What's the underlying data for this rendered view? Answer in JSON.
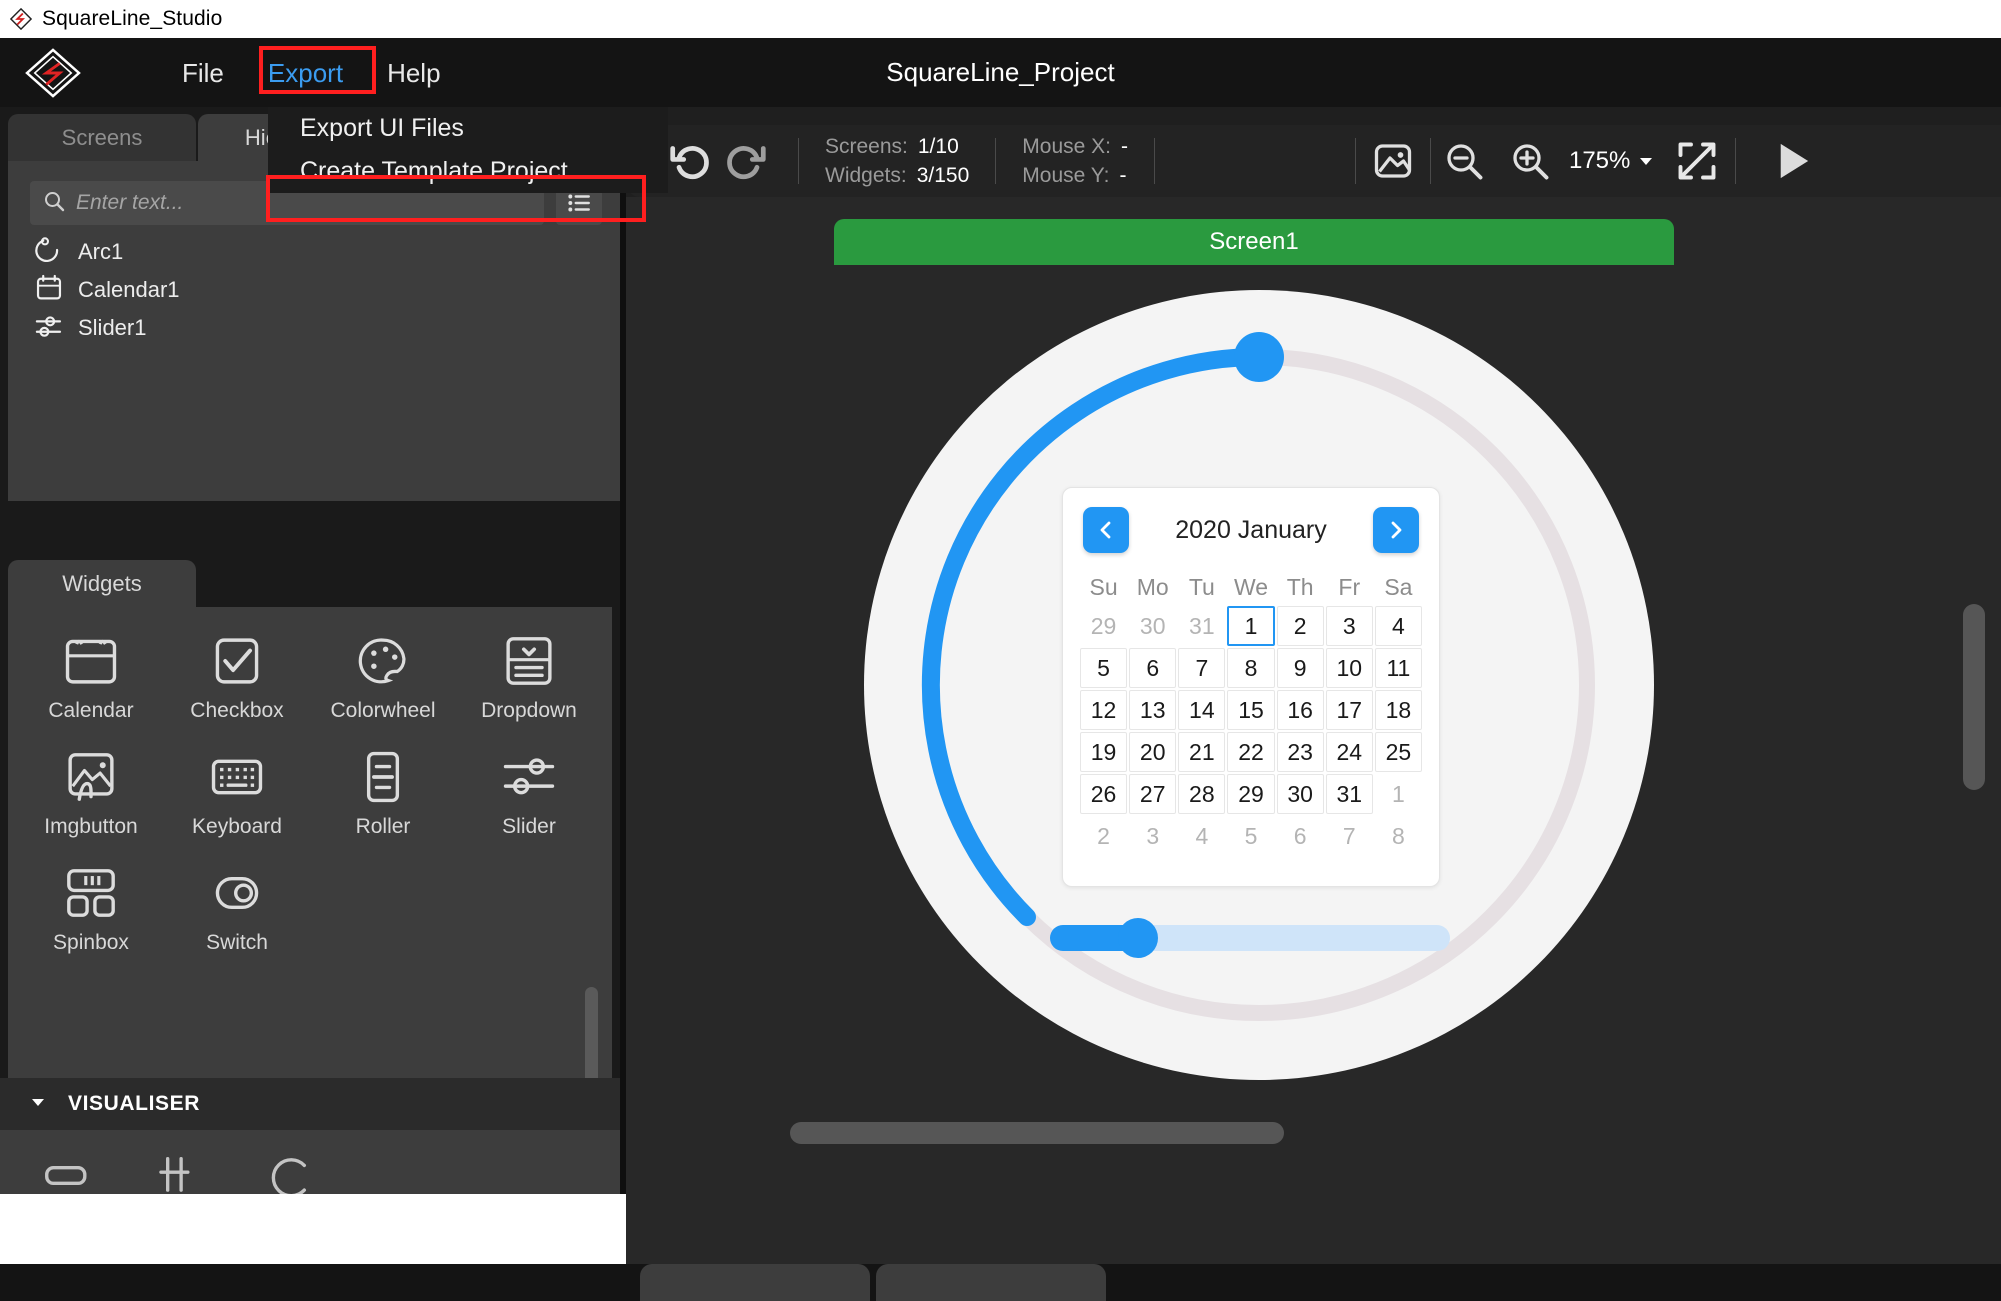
{
  "window": {
    "os_title": "SquareLine_Studio",
    "app_icon": "squareline-logo-icon"
  },
  "menubar": {
    "project_title": "SquareLine_Project",
    "items": [
      {
        "label": "File",
        "active": false
      },
      {
        "label": "Export",
        "active": true
      },
      {
        "label": "Help",
        "active": false
      }
    ],
    "highlight_color": "#ff1f1f",
    "active_color": "#3b9cf0"
  },
  "export_menu": {
    "open": true,
    "items": [
      {
        "label": "Export UI Files",
        "highlighted": false
      },
      {
        "label": "Create Template Project",
        "highlighted": true
      }
    ]
  },
  "left_panel": {
    "tree_tabs": [
      {
        "label": "Screens",
        "selected": false
      },
      {
        "label": "Hierarchy",
        "selected": true
      }
    ],
    "search": {
      "value": "",
      "placeholder": "Enter text...",
      "icon": "search-icon"
    },
    "list_view_icon": "list-view-icon",
    "tree_items": [
      {
        "label": "Arc1",
        "icon": "arc-icon"
      },
      {
        "label": "Calendar1",
        "icon": "calendar-icon"
      },
      {
        "label": "Slider1",
        "icon": "slider-icon"
      }
    ],
    "widgets_tab": {
      "label": "Widgets",
      "selected": true
    },
    "widgets": [
      {
        "label": "Calendar",
        "icon": "calendar-icon"
      },
      {
        "label": "Checkbox",
        "icon": "checkbox-icon"
      },
      {
        "label": "Colorwheel",
        "icon": "palette-icon"
      },
      {
        "label": "Dropdown",
        "icon": "dropdown-icon"
      },
      {
        "label": "Imgbutton",
        "icon": "image-button-icon"
      },
      {
        "label": "Keyboard",
        "icon": "keyboard-icon"
      },
      {
        "label": "Roller",
        "icon": "roller-icon"
      },
      {
        "label": "Slider",
        "icon": "slider-icon"
      },
      {
        "label": "Spinbox",
        "icon": "spinbox-icon"
      },
      {
        "label": "Switch",
        "icon": "switch-icon"
      }
    ],
    "visualiser": {
      "title": "VISUALISER",
      "expanded": true,
      "chevron_icon": "chevron-down-icon"
    }
  },
  "toolbar": {
    "undo_icon": "undo-icon",
    "redo_icon": "redo-icon",
    "stats": [
      {
        "label": "Screens:",
        "value": "1/10"
      },
      {
        "label": "Widgets:",
        "value": "3/150"
      }
    ],
    "mouse": [
      {
        "label": "Mouse X:",
        "value": "-"
      },
      {
        "label": "Mouse Y:",
        "value": "-"
      }
    ],
    "image_icon": "image-icon",
    "zoom_out_icon": "zoom-out-icon",
    "zoom_in_icon": "zoom-in-icon",
    "zoom_level": "175%",
    "zoom_dropdown_icon": "chevron-down-icon",
    "fit_screen_icon": "fit-screen-icon",
    "play_icon": "play-icon"
  },
  "canvas": {
    "screen_label": "Screen1",
    "screen_label_color": "#2a9a3f",
    "accent_color": "#2196f3",
    "arc": {
      "value_percent": 62,
      "track_color": "#e6e0e3",
      "indicator_color": "#2196f3",
      "knob_icon": "arc-knob-icon"
    },
    "calendar": {
      "title": "2020 January",
      "prev_icon": "chevron-left-icon",
      "next_icon": "chevron-right-icon",
      "day_headers": [
        "Su",
        "Mo",
        "Tu",
        "We",
        "Th",
        "Fr",
        "Sa"
      ],
      "today": "1",
      "weeks": [
        [
          {
            "d": "29",
            "muted": true
          },
          {
            "d": "30",
            "muted": true
          },
          {
            "d": "31",
            "muted": true
          },
          {
            "d": "1",
            "muted": false,
            "today": true
          },
          {
            "d": "2",
            "muted": false
          },
          {
            "d": "3",
            "muted": false
          },
          {
            "d": "4",
            "muted": false
          }
        ],
        [
          {
            "d": "5",
            "muted": false
          },
          {
            "d": "6",
            "muted": false
          },
          {
            "d": "7",
            "muted": false
          },
          {
            "d": "8",
            "muted": false
          },
          {
            "d": "9",
            "muted": false
          },
          {
            "d": "10",
            "muted": false
          },
          {
            "d": "11",
            "muted": false
          }
        ],
        [
          {
            "d": "12",
            "muted": false
          },
          {
            "d": "13",
            "muted": false
          },
          {
            "d": "14",
            "muted": false
          },
          {
            "d": "15",
            "muted": false
          },
          {
            "d": "16",
            "muted": false
          },
          {
            "d": "17",
            "muted": false
          },
          {
            "d": "18",
            "muted": false
          }
        ],
        [
          {
            "d": "19",
            "muted": false
          },
          {
            "d": "20",
            "muted": false
          },
          {
            "d": "21",
            "muted": false
          },
          {
            "d": "22",
            "muted": false
          },
          {
            "d": "23",
            "muted": false
          },
          {
            "d": "24",
            "muted": false
          },
          {
            "d": "25",
            "muted": false
          }
        ],
        [
          {
            "d": "26",
            "muted": false
          },
          {
            "d": "27",
            "muted": false
          },
          {
            "d": "28",
            "muted": false
          },
          {
            "d": "29",
            "muted": false
          },
          {
            "d": "30",
            "muted": false
          },
          {
            "d": "31",
            "muted": false
          },
          {
            "d": "1",
            "muted": true
          }
        ],
        [
          {
            "d": "2",
            "muted": true
          },
          {
            "d": "3",
            "muted": true
          },
          {
            "d": "4",
            "muted": true
          },
          {
            "d": "5",
            "muted": true
          },
          {
            "d": "6",
            "muted": true
          },
          {
            "d": "7",
            "muted": true
          },
          {
            "d": "8",
            "muted": true
          }
        ]
      ]
    },
    "slider": {
      "value_percent": 22,
      "track_color": "#cfe4f9",
      "fill_color": "#2196f3"
    }
  }
}
